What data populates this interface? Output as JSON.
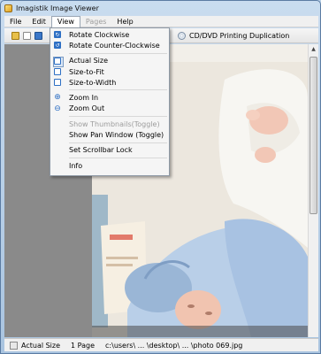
{
  "window": {
    "title": "Imagistik Image Viewer"
  },
  "menubar": [
    {
      "label": "File",
      "state": "normal"
    },
    {
      "label": "Edit",
      "state": "normal"
    },
    {
      "label": "View",
      "state": "open"
    },
    {
      "label": "Pages",
      "state": "disabled"
    },
    {
      "label": "Help",
      "state": "normal"
    }
  ],
  "toolbar": {
    "dvd_label": "CD/DVD Printing Duplication"
  },
  "view_menu": {
    "rotate_cw": "Rotate Clockwise",
    "rotate_ccw": "Rotate Counter-Clockwise",
    "actual_size": "Actual Size",
    "size_to_fit": "Size-to-Fit",
    "size_to_width": "Size-to-Width",
    "zoom_in": "Zoom In",
    "zoom_out": "Zoom Out",
    "show_thumbnails": "Show Thumbnails(Toggle)",
    "show_pan": "Show Pan Window (Toggle)",
    "set_scrollbar_lock": "Set Scrollbar Lock",
    "info": "Info"
  },
  "status": {
    "size_mode": "Actual Size",
    "pages": "1 Page",
    "path": "c:\\users\\ ... \\desktop\\ ... \\photo 069.jpg"
  },
  "colors": {
    "left_pane": "#8a8a8a",
    "menu_bg": "#f5f5f5",
    "accent": "#2d6fc4"
  }
}
